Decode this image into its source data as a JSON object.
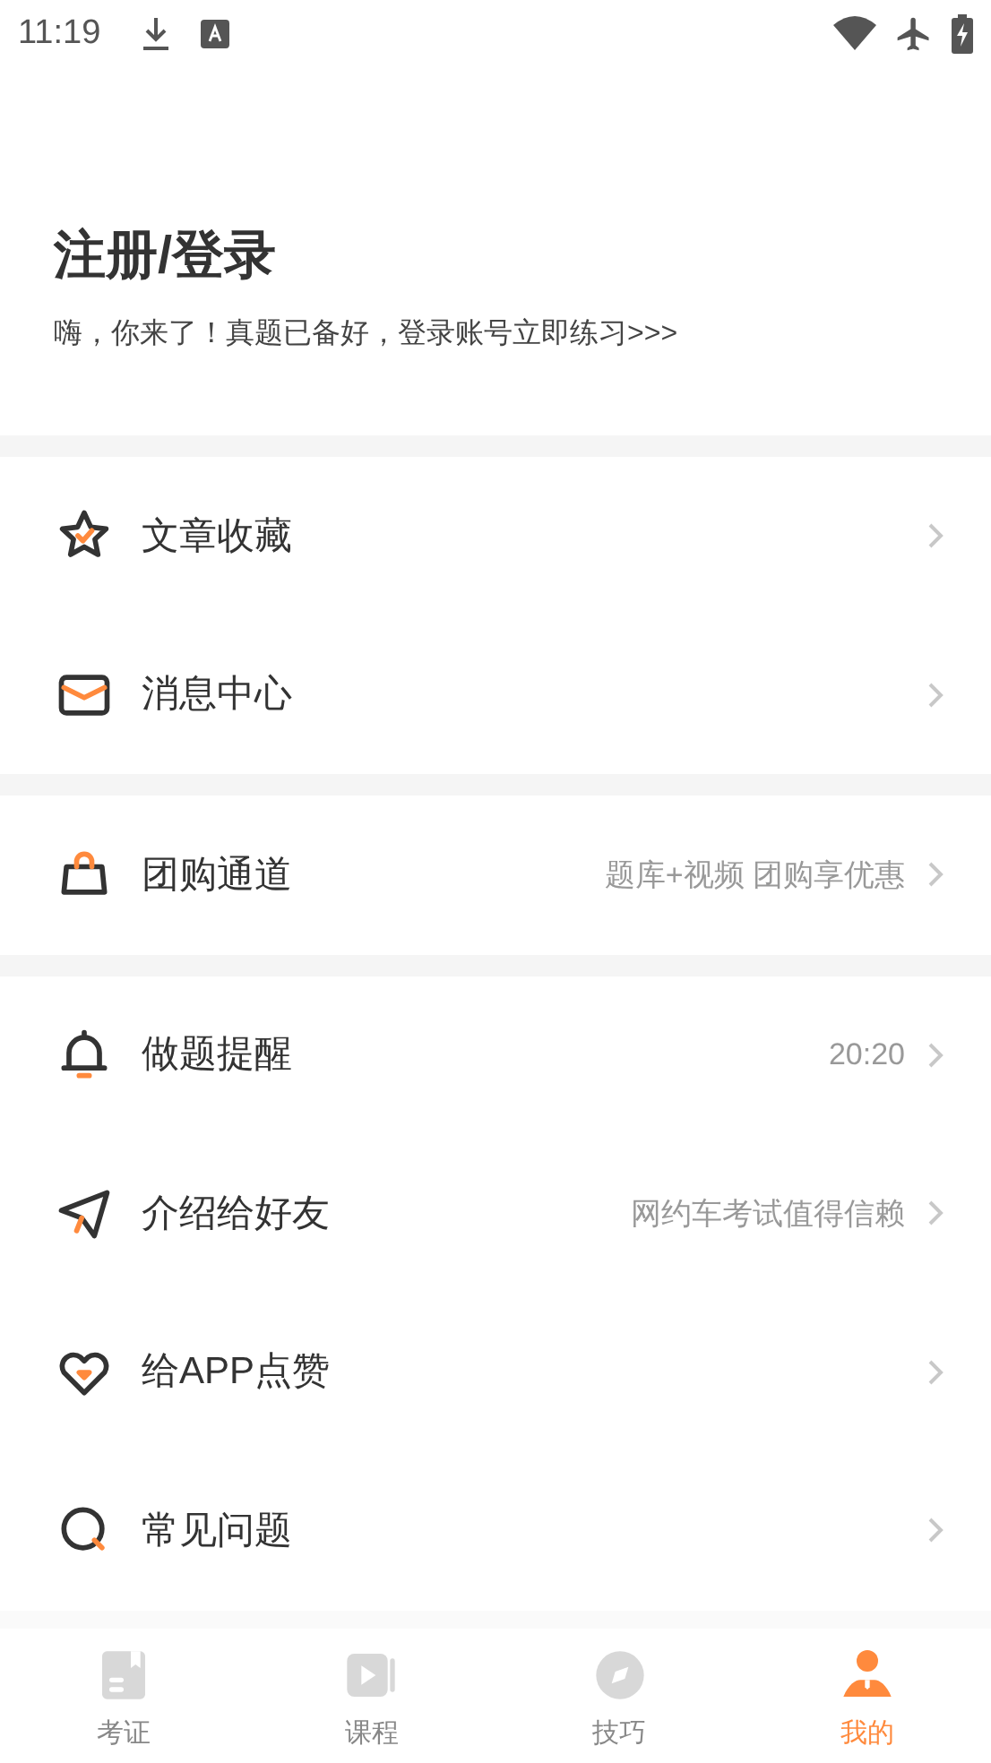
{
  "status_bar": {
    "time": "11:19"
  },
  "header": {
    "title": "注册/登录",
    "subtitle": "嗨，你来了！真题已备好，登录账号立即练习>>>"
  },
  "groups": [
    {
      "items": [
        {
          "kind": "star",
          "label": "文章收藏"
        },
        {
          "kind": "mail",
          "label": "消息中心"
        }
      ]
    },
    {
      "items": [
        {
          "kind": "bag",
          "label": "团购通道",
          "detail": "题库+视频 团购享优惠"
        }
      ]
    },
    {
      "items": [
        {
          "kind": "bell",
          "label": "做题提醒",
          "detail": "20:20"
        },
        {
          "kind": "plane",
          "label": "介绍给好友",
          "detail": "网约车考试值得信赖"
        },
        {
          "kind": "heart",
          "label": "给APP点赞"
        },
        {
          "kind": "question",
          "label": "常见问题"
        }
      ]
    }
  ],
  "tab_bar": [
    {
      "kind": "book",
      "label": "考证",
      "selected": false
    },
    {
      "kind": "video",
      "label": "课程",
      "selected": false
    },
    {
      "kind": "compass",
      "label": "技巧",
      "selected": false
    },
    {
      "kind": "person",
      "label": "我的",
      "selected": true
    }
  ]
}
